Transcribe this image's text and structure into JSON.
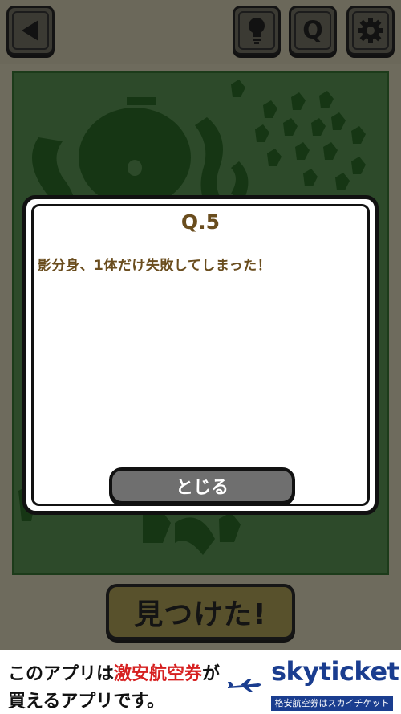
{
  "toolbar": {
    "back_icon": "back-arrow-icon",
    "hint_icon": "lightbulb-icon",
    "question_label": "Q",
    "settings_icon": "gear-icon"
  },
  "game": {
    "find_button_label": "見つけた!"
  },
  "modal": {
    "title": "Q.5",
    "body": "影分身、1体だけ失敗してしまった！",
    "close_label": "とじる"
  },
  "ad": {
    "line1_prefix": "このアプリは",
    "line1_highlight": "激安航空券",
    "line1_suffix": "が",
    "line2": "買えるアプリです。",
    "logo": "skyticket",
    "tagline": "格安航空券はスカイチケット"
  },
  "colors": {
    "scene_green": "#2d4a2a",
    "text_brown": "#6a4d1e",
    "ad_blue": "#1a3d8f",
    "ad_red": "#d62020"
  }
}
